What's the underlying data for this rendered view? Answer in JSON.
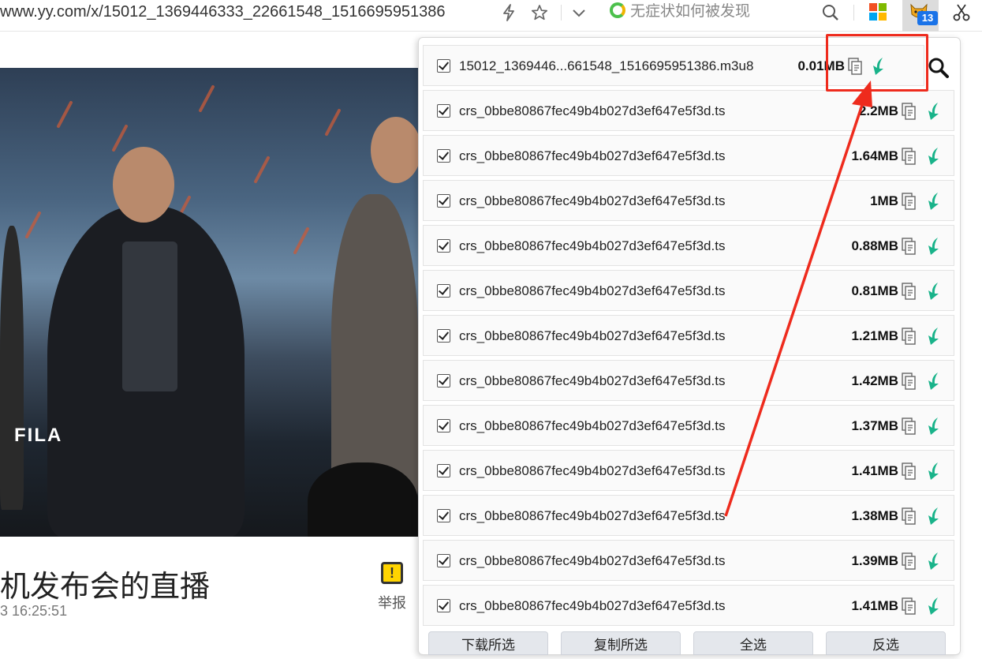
{
  "browser": {
    "url": "www.yy.com/x/15012_1369446333_22661548_1516695951386",
    "search_hint": "无症状如何被发现",
    "extension_badge": "13",
    "icons": [
      "lightning-icon",
      "star-icon",
      "chevron-down-icon",
      "search-icon",
      "microsoft-logo-icon",
      "cat-extension-icon",
      "scissors-icon"
    ]
  },
  "page": {
    "title_visible": "机发布会的直播",
    "time_visible": "3 16:25:51",
    "report_label": "举报",
    "video_logo_text": "FILA"
  },
  "popup": {
    "files": [
      {
        "name": "15012_1369446...661548_1516695951386.m3u8",
        "size": "0.01MB"
      },
      {
        "name": "crs_0bbe80867fec49b4b027d3ef647e5f3d.ts",
        "size": "2.2MB"
      },
      {
        "name": "crs_0bbe80867fec49b4b027d3ef647e5f3d.ts",
        "size": "1.64MB"
      },
      {
        "name": "crs_0bbe80867fec49b4b027d3ef647e5f3d.ts",
        "size": "1MB"
      },
      {
        "name": "crs_0bbe80867fec49b4b027d3ef647e5f3d.ts",
        "size": "0.88MB"
      },
      {
        "name": "crs_0bbe80867fec49b4b027d3ef647e5f3d.ts",
        "size": "0.81MB"
      },
      {
        "name": "crs_0bbe80867fec49b4b027d3ef647e5f3d.ts",
        "size": "1.21MB"
      },
      {
        "name": "crs_0bbe80867fec49b4b027d3ef647e5f3d.ts",
        "size": "1.42MB"
      },
      {
        "name": "crs_0bbe80867fec49b4b027d3ef647e5f3d.ts",
        "size": "1.37MB"
      },
      {
        "name": "crs_0bbe80867fec49b4b027d3ef647e5f3d.ts",
        "size": "1.41MB"
      },
      {
        "name": "crs_0bbe80867fec49b4b027d3ef647e5f3d.ts",
        "size": "1.38MB"
      },
      {
        "name": "crs_0bbe80867fec49b4b027d3ef647e5f3d.ts",
        "size": "1.39MB"
      },
      {
        "name": "crs_0bbe80867fec49b4b027d3ef647e5f3d.ts",
        "size": "1.41MB"
      }
    ],
    "buttons": {
      "download_selected": "下载所选",
      "copy_selected": "复制所选",
      "select_all": "全选",
      "invert_selection": "反选"
    }
  },
  "colors": {
    "annotation_red": "#ee2b1d",
    "download_green": "#19b38a",
    "extension_badge_blue": "#1a73e8"
  }
}
